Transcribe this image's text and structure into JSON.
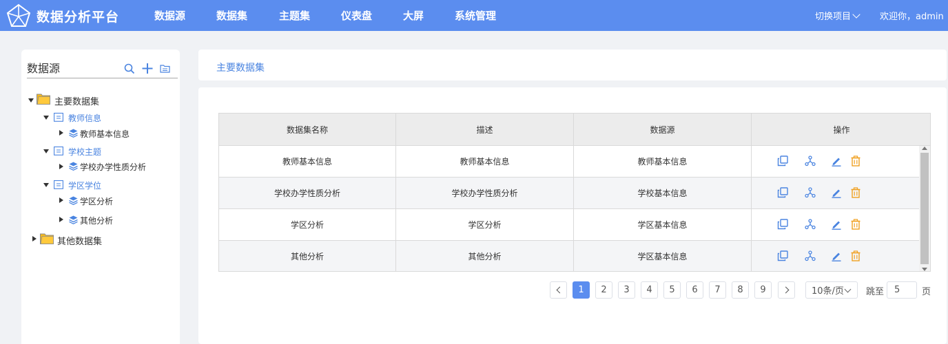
{
  "app": {
    "title": "数据分析平台"
  },
  "nav": {
    "items": [
      "数据源",
      "数据集",
      "主题集",
      "仪表盘",
      "大屏",
      "系统管理"
    ],
    "switch_project": "切换项目",
    "welcome": "欢迎你，admin"
  },
  "sidebar": {
    "title": "数据源",
    "tree": {
      "root1": "主要数据集",
      "group1": "教师信息",
      "group1_item": "教师基本信息",
      "group2": "学校主题",
      "group2_item": "学校办学性质分析",
      "group3": "学区学位",
      "group3_item1": "学区分析",
      "group3_item2": "其他分析",
      "root2": "其他数据集"
    }
  },
  "main": {
    "header_title": "主要数据集",
    "table": {
      "columns": [
        "数据集名称",
        "描述",
        "数据源",
        "操作"
      ],
      "rows": [
        [
          "教师基本信息",
          "教师基本信息",
          "教师基本信息"
        ],
        [
          "学校办学性质分析",
          "学校办学性质分析",
          "学校基本信息"
        ],
        [
          "学区分析",
          "学区分析",
          "学区基本信息"
        ],
        [
          "其他分析",
          "其他分析",
          "学区基本信息"
        ]
      ]
    },
    "pagination": {
      "pages": [
        "1",
        "2",
        "3",
        "4",
        "5",
        "6",
        "7",
        "8",
        "9"
      ],
      "current": "1",
      "page_size": "10条/页",
      "jump_label": "跳至",
      "jump_value": "5",
      "page_label": "页"
    }
  },
  "colors": {
    "brand": "#5b8def",
    "link": "#4a84e0",
    "folder": "#f6b91b",
    "delete": "#f0a020"
  },
  "icons": [
    "logo-icon",
    "search-icon",
    "plus-icon",
    "folder-outline-icon",
    "folder-icon",
    "document-icon",
    "layers-icon",
    "copy-icon",
    "share-icon",
    "edit-icon",
    "delete-icon"
  ]
}
